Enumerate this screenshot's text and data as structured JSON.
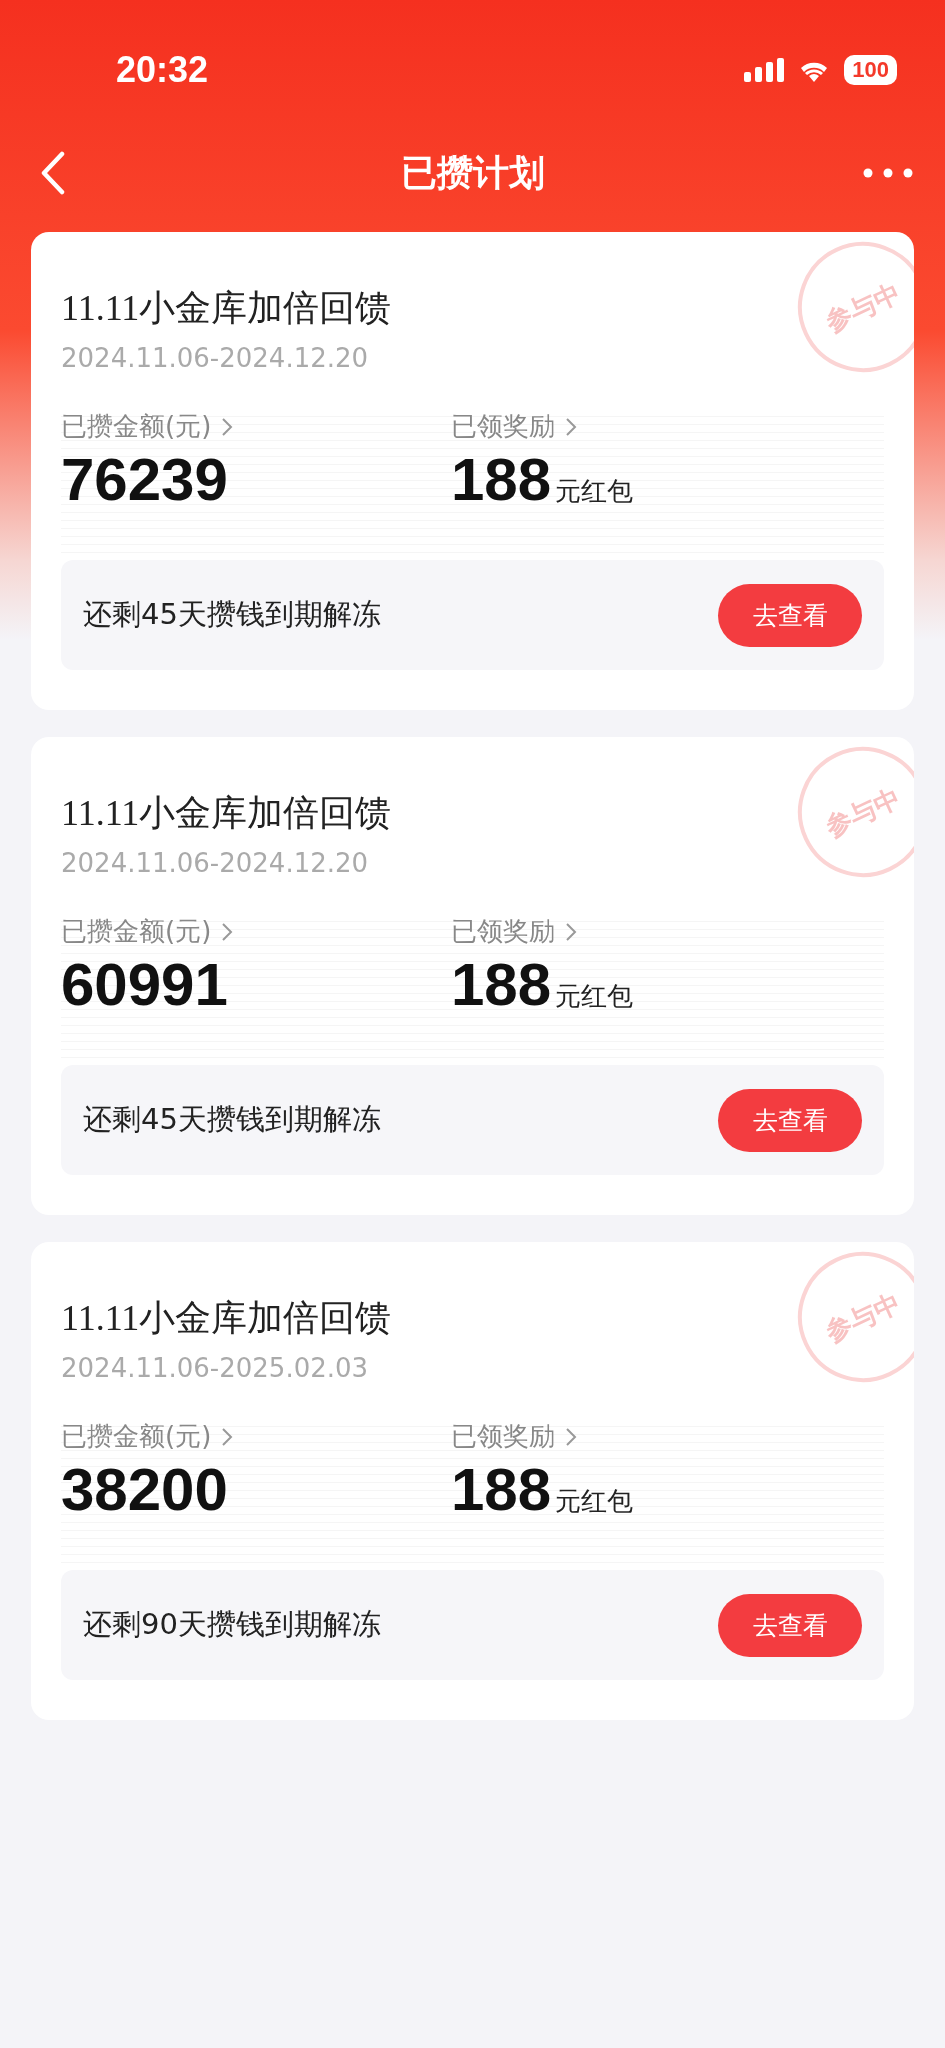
{
  "status_bar": {
    "time": "20:32",
    "battery": "100"
  },
  "nav": {
    "title": "已攒计划"
  },
  "plans": [
    {
      "title": "11.11小金库加倍回馈",
      "period": "2024.11.06-2024.12.20",
      "stamp": "参与中",
      "saved_label": "已攒金额(元)",
      "saved": "76239",
      "reward_label": "已领奖励",
      "reward": "188",
      "reward_unit": "元红包",
      "note": "还剩45天攒钱到期解冻",
      "button": "去查看"
    },
    {
      "title": "11.11小金库加倍回馈",
      "period": "2024.11.06-2024.12.20",
      "stamp": "参与中",
      "saved_label": "已攒金额(元)",
      "saved": "60991",
      "reward_label": "已领奖励",
      "reward": "188",
      "reward_unit": "元红包",
      "note": "还剩45天攒钱到期解冻",
      "button": "去查看"
    },
    {
      "title": "11.11小金库加倍回馈",
      "period": "2024.11.06-2025.02.03",
      "stamp": "参与中",
      "saved_label": "已攒金额(元)",
      "saved": "38200",
      "reward_label": "已领奖励",
      "reward": "188",
      "reward_unit": "元红包",
      "note": "还剩90天攒钱到期解冻",
      "button": "去查看"
    }
  ]
}
